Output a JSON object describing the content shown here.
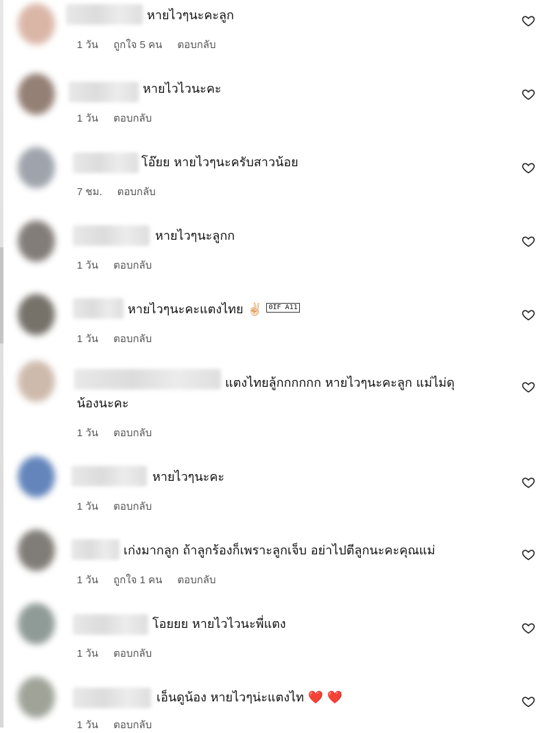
{
  "comments": [
    {
      "text": "หายไวๆนะคะลูก",
      "time": "1 วัน",
      "likes": "ถูกใจ 5 คน",
      "reply": "ตอบกลับ",
      "avatar_color": "#d9b3a3"
    },
    {
      "text": "หายไวไวนะคะ",
      "time": "1 วัน",
      "likes": "",
      "reply": "ตอบกลับ",
      "avatar_color": "#8f7a6e"
    },
    {
      "text": "โอ๊ยย หายไวๆนะครับสาวน้อย",
      "time": "7 ชม.",
      "likes": "",
      "reply": "ตอบกลับ",
      "avatar_color": "#9aa0a8"
    },
    {
      "text": "หายไวๆนะลูกก",
      "time": "1 วัน",
      "likes": "",
      "reply": "ตอบกลับ",
      "avatar_color": "#7d7772"
    },
    {
      "text": "หายไวๆนะคะแตงไทย",
      "emoji": "✌🏻",
      "box_glyph": "0IF A11",
      "time": "1 วัน",
      "likes": "",
      "reply": "ตอบกลับ",
      "avatar_color": "#6f6b63"
    },
    {
      "text": "แตงไทยลู้กกกกกก หายไวๆนะคะลูก แม่ไม่ดุ",
      "text2": "น้องนะคะ",
      "time": "1 วัน",
      "likes": "",
      "reply": "ตอบกลับ",
      "avatar_color": "#cbb7a8"
    },
    {
      "text": "หายไวๆนะคะ",
      "time": "1 วัน",
      "likes": "",
      "reply": "ตอบกลับ",
      "avatar_color": "#5c7fb8"
    },
    {
      "text": "เก่งมากลูก ถ้าลูกร้องก็เพราะลูกเจ็บ อย่าไปตีลูกนะคะคุณแม่",
      "time": "1 วัน",
      "likes": "ถูกใจ 1 คน",
      "reply": "ตอบกลับ",
      "avatar_color": "#7a7670"
    },
    {
      "text": "โอยยย หายไวไวนะพี่แตง",
      "time": "1 วัน",
      "likes": "",
      "reply": "ตอบกลับ",
      "avatar_color": "#8a9692"
    },
    {
      "text": "เอ็นดูน้อง หายไวๆน่ะแตงไท",
      "hearts": "❤️ ❤️",
      "time": "1 วัน",
      "likes": "",
      "reply": "ตอบกลับ",
      "avatar_color": "#9a9f93"
    }
  ],
  "icons": {
    "like": "heart-outline-icon",
    "reaction": "red-heart-icon"
  }
}
